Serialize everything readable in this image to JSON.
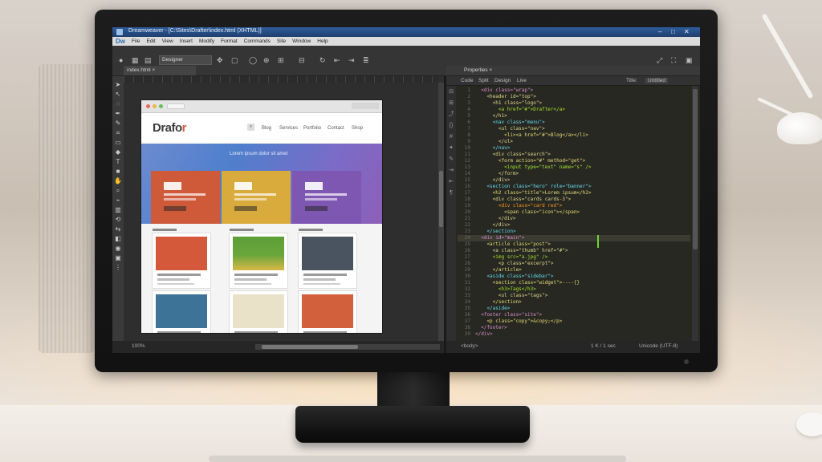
{
  "window": {
    "title": "Dreamweaver - [C:\\Sites\\Drafter\\index.html (XHTML)]",
    "controls": [
      "–",
      "□",
      "✕"
    ]
  },
  "menu": {
    "logo": "Dw",
    "items": [
      "File",
      "Edit",
      "View",
      "Insert",
      "Modify",
      "Format",
      "Commands",
      "Site",
      "Window",
      "Help"
    ]
  },
  "options_bar": {
    "preset": "Designer"
  },
  "design_view": {
    "doc_tab": "index.html  ×",
    "zoom": "100%"
  },
  "artboard": {
    "logo_main": "Drafo",
    "logo_accent": "r",
    "search_label": "⌕",
    "nav": [
      "Blog",
      "Services",
      "Portfolio",
      "Contact",
      "Shop"
    ],
    "hero_heading": "Lorem ipsum dolor sit amet",
    "colors": {
      "card1": "#cf5a3a",
      "card2": "#d9ab3c",
      "card3": "#7e57b3",
      "grid1": "#d4593a",
      "grid2": "#5d9e37",
      "grid3": "#4a5360",
      "grid4": "#3e7398",
      "grid5": "#e9e2c8",
      "grid6": "#d2603c"
    }
  },
  "code_view": {
    "tab": "Properties  ×",
    "toolbar": [
      "Code",
      "Split",
      "Design",
      "Live",
      "Title:",
      "Untitled"
    ],
    "status": [
      "<body>",
      "1 K / 1 sec",
      "Unicode (UTF-8)"
    ],
    "lines": [
      {
        "t": "  <div class=\"wrap\">",
        "c": "#d98ec9"
      },
      {
        "t": "    <header id=\"top\">",
        "c": "#e0d68a"
      },
      {
        "t": "      <h1 class=\"logo\">",
        "c": "#e0d68a"
      },
      {
        "t": "        <a href=\"#\">Drafter</a>",
        "c": "#a6e22e"
      },
      {
        "t": "      </h1>",
        "c": "#e0d68a"
      },
      {
        "t": "      <nav class=\"menu\">",
        "c": "#66d9ef"
      },
      {
        "t": "        <ul class=\"nav\">",
        "c": "#e0d68a"
      },
      {
        "t": "          <li><a href=\"#\">Blog</a></li>",
        "c": "#e6db74"
      },
      {
        "t": "        </ul>",
        "c": "#e0d68a"
      },
      {
        "t": "      </nav>",
        "c": "#66d9ef"
      },
      {
        "t": "      <div class=\"search\">",
        "c": "#e0d68a"
      },
      {
        "t": "        <form action=\"#\" method=\"get\">",
        "c": "#e6db74"
      },
      {
        "t": "          <input type=\"text\" name=\"s\" />",
        "c": "#a6e22e"
      },
      {
        "t": "        </form>",
        "c": "#e0d68a"
      },
      {
        "t": "      </div>",
        "c": "#e0d68a"
      },
      {
        "t": "    <section class=\"hero\" role=\"banner\">",
        "c": "#66d9ef"
      },
      {
        "t": "      <h2 class=\"title\">Lorem ipsum</h2>",
        "c": "#e6db74"
      },
      {
        "t": "      <div class=\"cards cards-3\">",
        "c": "#e0d68a"
      },
      {
        "t": "        <div class=\"card red\">",
        "c": "#fd971f"
      },
      {
        "t": "          <span class=\"icon\"></span>",
        "c": "#e6db74"
      },
      {
        "t": "        </div>",
        "c": "#e0d68a"
      },
      {
        "t": "      </div>",
        "c": "#e0d68a"
      },
      {
        "t": "    </section>",
        "c": "#66d9ef"
      },
      {
        "t": "  <div id=\"main\">",
        "c": "#d98ec9"
      },
      {
        "t": "    <article class=\"post\">",
        "c": "#e6db74"
      },
      {
        "t": "      <a class=\"thumb\" href=\"#\">",
        "c": "#e0d68a"
      },
      {
        "t": "      <img src=\"a.jpg\" />",
        "c": "#a6e22e"
      },
      {
        "t": "        <p class=\"excerpt\">",
        "c": "#e0d68a"
      },
      {
        "t": "      </article>",
        "c": "#e6db74"
      },
      {
        "t": "    <aside class=\"sidebar\">",
        "c": "#66d9ef"
      },
      {
        "t": "      <section class=\"widget\">----{}",
        "c": "#e6db74"
      },
      {
        "t": "        <h3>Tags</h3>",
        "c": "#a6e22e"
      },
      {
        "t": "        <ul class=\"tags\">",
        "c": "#e0d68a"
      },
      {
        "t": "      </section>",
        "c": "#e6db74"
      },
      {
        "t": "    </aside>",
        "c": "#66d9ef"
      },
      {
        "t": "  <footer class=\"site\">",
        "c": "#d98ec9"
      },
      {
        "t": "    <p class=\"copy\">&copy;</p>",
        "c": "#e6db74"
      },
      {
        "t": "  </footer>",
        "c": "#d98ec9"
      },
      {
        "t": "</div>",
        "c": "#d98ec9"
      }
    ]
  }
}
